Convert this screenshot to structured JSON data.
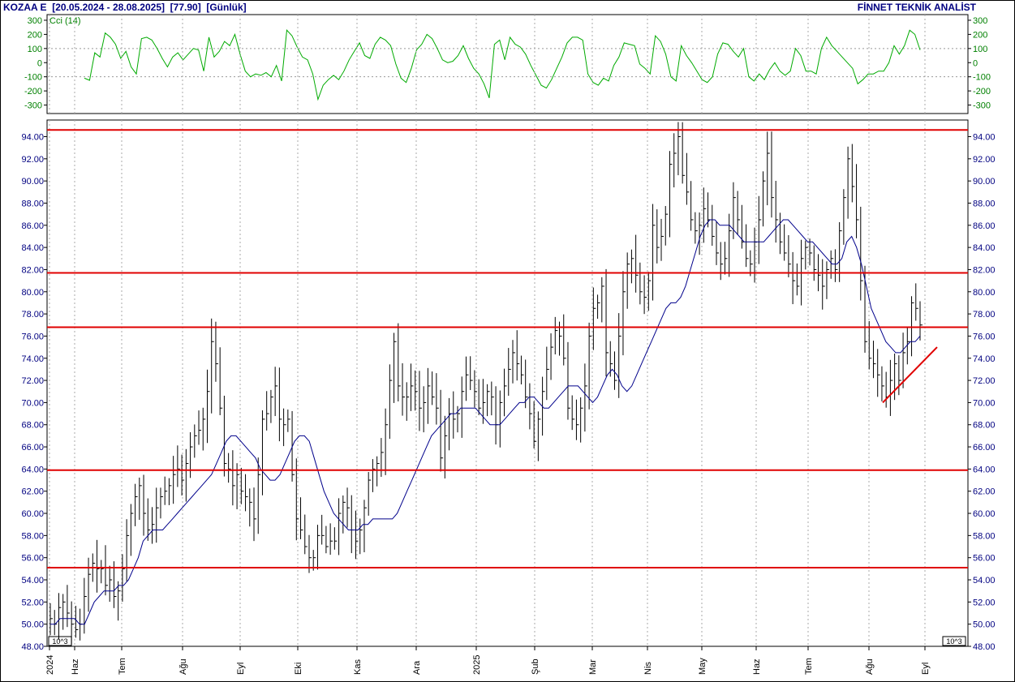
{
  "header": {
    "title": "KOZAA E  [20.05.2024 - 28.08.2025]  [77.90]  [Günlük]",
    "brand": "FİNNET TEKNİK ANALİST"
  },
  "chart_data": [
    {
      "type": "line",
      "name": "cci-panel",
      "series": [
        {
          "name": "Cci (14)",
          "color": "#00aa00",
          "values": [
            -110,
            -125,
            70,
            40,
            210,
            180,
            130,
            30,
            80,
            -30,
            -80,
            170,
            180,
            160,
            100,
            30,
            -30,
            40,
            70,
            20,
            60,
            100,
            90,
            -60,
            180,
            40,
            80,
            150,
            120,
            200,
            60,
            -60,
            -100,
            -80,
            -90,
            -70,
            -100,
            -20,
            -130,
            230,
            190,
            110,
            40,
            20,
            -80,
            -260,
            -160,
            -120,
            -90,
            -120,
            -60,
            20,
            80,
            140,
            50,
            30,
            130,
            180,
            160,
            120,
            -10,
            -110,
            -140,
            -40,
            90,
            130,
            200,
            170,
            100,
            20,
            0,
            10,
            50,
            120,
            30,
            -40,
            -80,
            -150,
            -250,
            130,
            160,
            20,
            180,
            130,
            110,
            60,
            -20,
            -90,
            -160,
            -180,
            -120,
            -40,
            40,
            140,
            180,
            180,
            160,
            -80,
            -140,
            -160,
            -110,
            -130,
            -20,
            40,
            140,
            130,
            120,
            -10,
            -40,
            -80,
            190,
            150,
            60,
            -100,
            -130,
            120,
            50,
            0,
            -60,
            -120,
            -140,
            -100,
            60,
            140,
            130,
            80,
            40,
            100,
            -100,
            -130,
            -80,
            -120,
            -50,
            0,
            -60,
            -90,
            -60,
            100,
            50,
            -60,
            -60,
            -80,
            100,
            180,
            120,
            80,
            40,
            0,
            -40,
            -150,
            -120,
            -80,
            -80,
            -60,
            -60,
            0,
            120,
            60,
            120,
            230,
            200,
            90
          ],
          "ylim": [
            -360,
            340
          ],
          "ticks": [
            300,
            200,
            100,
            0,
            -100,
            -200,
            -300
          ],
          "reference_lines": [
            100,
            -100
          ]
        }
      ]
    },
    {
      "type": "line",
      "name": "price-panel",
      "ylim": [
        48,
        95.5
      ],
      "ticks": [
        94,
        92,
        90,
        88,
        86,
        84,
        82,
        80,
        78,
        76,
        74,
        72,
        70,
        68,
        66,
        64,
        62,
        60,
        58,
        56,
        54,
        52,
        50,
        48
      ],
      "tick_labels": [
        "94.00",
        "92.00",
        "90.00",
        "88.00",
        "86.00",
        "84.00",
        "82.00",
        "80.00",
        "78.00",
        "76.00",
        "74.00",
        "72.00",
        "70.00",
        "68.00",
        "66.00",
        "64.00",
        "62.00",
        "60.00",
        "58.00",
        "56.00",
        "54.00",
        "52.00",
        "50.00",
        "48.00"
      ],
      "x_labels": [
        "2024",
        "Haz",
        "Tem",
        "Ağu",
        "Eyl",
        "Eki",
        "Kas",
        "Ara",
        "2025",
        "Şub",
        "Mar",
        "Nis",
        "May",
        "Haz",
        "Tem",
        "Ağu",
        "Eyl"
      ],
      "scale_note": "10^3",
      "price_closes": [
        50.5,
        50.0,
        51.5,
        52.0,
        51.0,
        50.0,
        49.5,
        50.0,
        52.5,
        54.5,
        55.5,
        55.0,
        55.0,
        53.5,
        54.0,
        52.5,
        53.0,
        55.0,
        58.0,
        60.0,
        61.5,
        62.5,
        60.0,
        58.5,
        59.0,
        60.5,
        61.5,
        62.0,
        62.5,
        63.5,
        64.0,
        63.0,
        64.5,
        66.0,
        67.0,
        67.5,
        68.5,
        71.0,
        75.5,
        73.5,
        69.5,
        64.5,
        64.0,
        62.5,
        63.5,
        62.0,
        61.5,
        61.0,
        59.5,
        63.5,
        68.5,
        69.0,
        70.5,
        71.5,
        68.5,
        68.0,
        68.5,
        63.5,
        59.5,
        58.5,
        57.0,
        56.0,
        56.0,
        58.0,
        58.0,
        57.0,
        57.5,
        57.5,
        60.0,
        61.0,
        60.5,
        58.5,
        57.5,
        58.5,
        60.5,
        63.0,
        64.0,
        64.5,
        65.5,
        68.0,
        72.0,
        75.5,
        71.5,
        70.5,
        70.5,
        71.5,
        71.0,
        69.5,
        70.0,
        71.5,
        70.5,
        69.5,
        65.0,
        67.0,
        69.0,
        68.5,
        69.0,
        71.0,
        72.5,
        72.0,
        71.0,
        69.5,
        70.0,
        71.0,
        70.5,
        68.0,
        70.0,
        71.5,
        73.0,
        74.5,
        73.5,
        72.5,
        70.5,
        69.0,
        66.5,
        68.5,
        71.0,
        73.0,
        75.0,
        76.5,
        76.0,
        74.0,
        69.5,
        68.5,
        68.0,
        69.5,
        71.5,
        76.0,
        78.5,
        79.0,
        80.5,
        74.5,
        73.5,
        72.0,
        76.0,
        80.0,
        82.5,
        83.0,
        81.5,
        80.0,
        79.5,
        81.0,
        86.0,
        84.0,
        85.0,
        87.0,
        91.5,
        92.5,
        94.0,
        90.5,
        89.0,
        86.5,
        85.5,
        86.0,
        87.5,
        86.5,
        85.0,
        83.5,
        82.5,
        83.0,
        85.5,
        88.5,
        86.5,
        84.5,
        83.0,
        82.5,
        84.5,
        86.5,
        90.0,
        92.5,
        88.5,
        86.5,
        84.5,
        83.5,
        82.5,
        81.0,
        80.5,
        83.0,
        84.0,
        83.5,
        82.0,
        81.5,
        80.5,
        82.0,
        83.0,
        82.0,
        85.5,
        88.5,
        92.0,
        89.5,
        86.5,
        81.0,
        75.5,
        74.0,
        73.5,
        72.5,
        71.5,
        70.5,
        72.0,
        73.5,
        72.0,
        74.5,
        75.5,
        79.0,
        78.5,
        77.0
      ],
      "moving_average": [
        50.0,
        50.0,
        50.5,
        50.5,
        50.5,
        50.5,
        50.0,
        50.0,
        51.0,
        52.0,
        52.5,
        53.0,
        53.0,
        53.0,
        53.5,
        53.5,
        54.0,
        55.0,
        56.0,
        57.5,
        58.0,
        58.5,
        58.5,
        58.5,
        59.0,
        59.5,
        60.0,
        60.5,
        61.0,
        61.5,
        62.0,
        62.5,
        63.0,
        63.5,
        64.5,
        65.5,
        66.5,
        67.0,
        67.0,
        66.5,
        66.0,
        65.5,
        65.0,
        64.0,
        63.5,
        63.0,
        63.0,
        63.5,
        64.5,
        65.5,
        66.5,
        67.0,
        67.0,
        66.5,
        65.0,
        63.5,
        62.0,
        61.0,
        60.0,
        59.5,
        59.0,
        58.5,
        58.5,
        58.5,
        59.0,
        59.0,
        59.5,
        59.5,
        59.5,
        59.5,
        59.5,
        60.0,
        61.0,
        62.0,
        63.0,
        64.0,
        65.0,
        66.0,
        67.0,
        67.5,
        68.0,
        68.5,
        69.0,
        69.0,
        69.5,
        69.5,
        69.5,
        69.5,
        69.0,
        68.5,
        68.0,
        68.0,
        68.0,
        68.5,
        69.0,
        69.5,
        70.0,
        70.0,
        70.5,
        70.5,
        70.0,
        69.5,
        69.5,
        70.0,
        70.5,
        71.0,
        71.5,
        71.5,
        71.5,
        71.0,
        70.5,
        70.0,
        70.5,
        71.5,
        72.5,
        73.0,
        72.5,
        71.5,
        71.0,
        71.5,
        72.5,
        73.5,
        74.5,
        75.5,
        76.5,
        77.5,
        78.5,
        79.0,
        79.0,
        79.5,
        80.5,
        82.0,
        83.5,
        85.0,
        86.0,
        86.5,
        86.5,
        86.0,
        86.0,
        86.0,
        85.5,
        85.0,
        84.5,
        84.5,
        84.5,
        84.5,
        84.5,
        85.0,
        85.5,
        86.0,
        86.5,
        86.5,
        86.0,
        85.5,
        85.0,
        84.5,
        84.5,
        84.0,
        83.5,
        83.0,
        82.5,
        82.5,
        83.0,
        84.5,
        85.0,
        84.0,
        82.5,
        80.5,
        78.5,
        77.5,
        76.5,
        75.5,
        75.0,
        74.5,
        74.5,
        75.0,
        75.5,
        75.5,
        76.0
      ],
      "horizontal_levels": [
        94.6,
        81.7,
        76.8,
        63.9,
        55.1
      ],
      "trendline": {
        "from": 70.0,
        "to": 75.0
      },
      "colors": {
        "bars": "#000000",
        "moving_average": "#00008b",
        "levels": "#e00000",
        "trendline": "#e00000",
        "labels": "#000080",
        "grid": "#aaaaaa"
      }
    }
  ]
}
